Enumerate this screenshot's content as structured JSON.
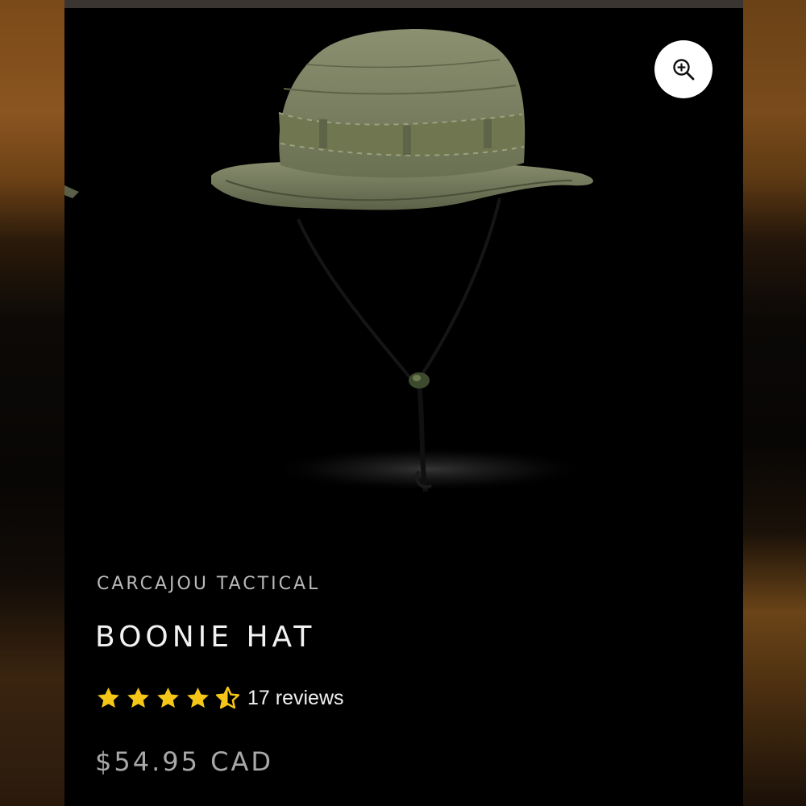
{
  "product": {
    "vendor": "CARCAJOU TACTICAL",
    "title": "BOONIE HAT",
    "rating": 4.5,
    "reviews_label": "17 reviews",
    "price": "$54.95 CAD"
  },
  "image": {
    "alt_icon": "olive-boonie-hat-image",
    "hat_color": "#7d8463",
    "zoom_icon": "zoom-in-icon"
  },
  "colors": {
    "background": "#000000",
    "star": "#f5c518",
    "text_primary": "#f2f2f2",
    "text_muted": "#b9b9b9"
  }
}
